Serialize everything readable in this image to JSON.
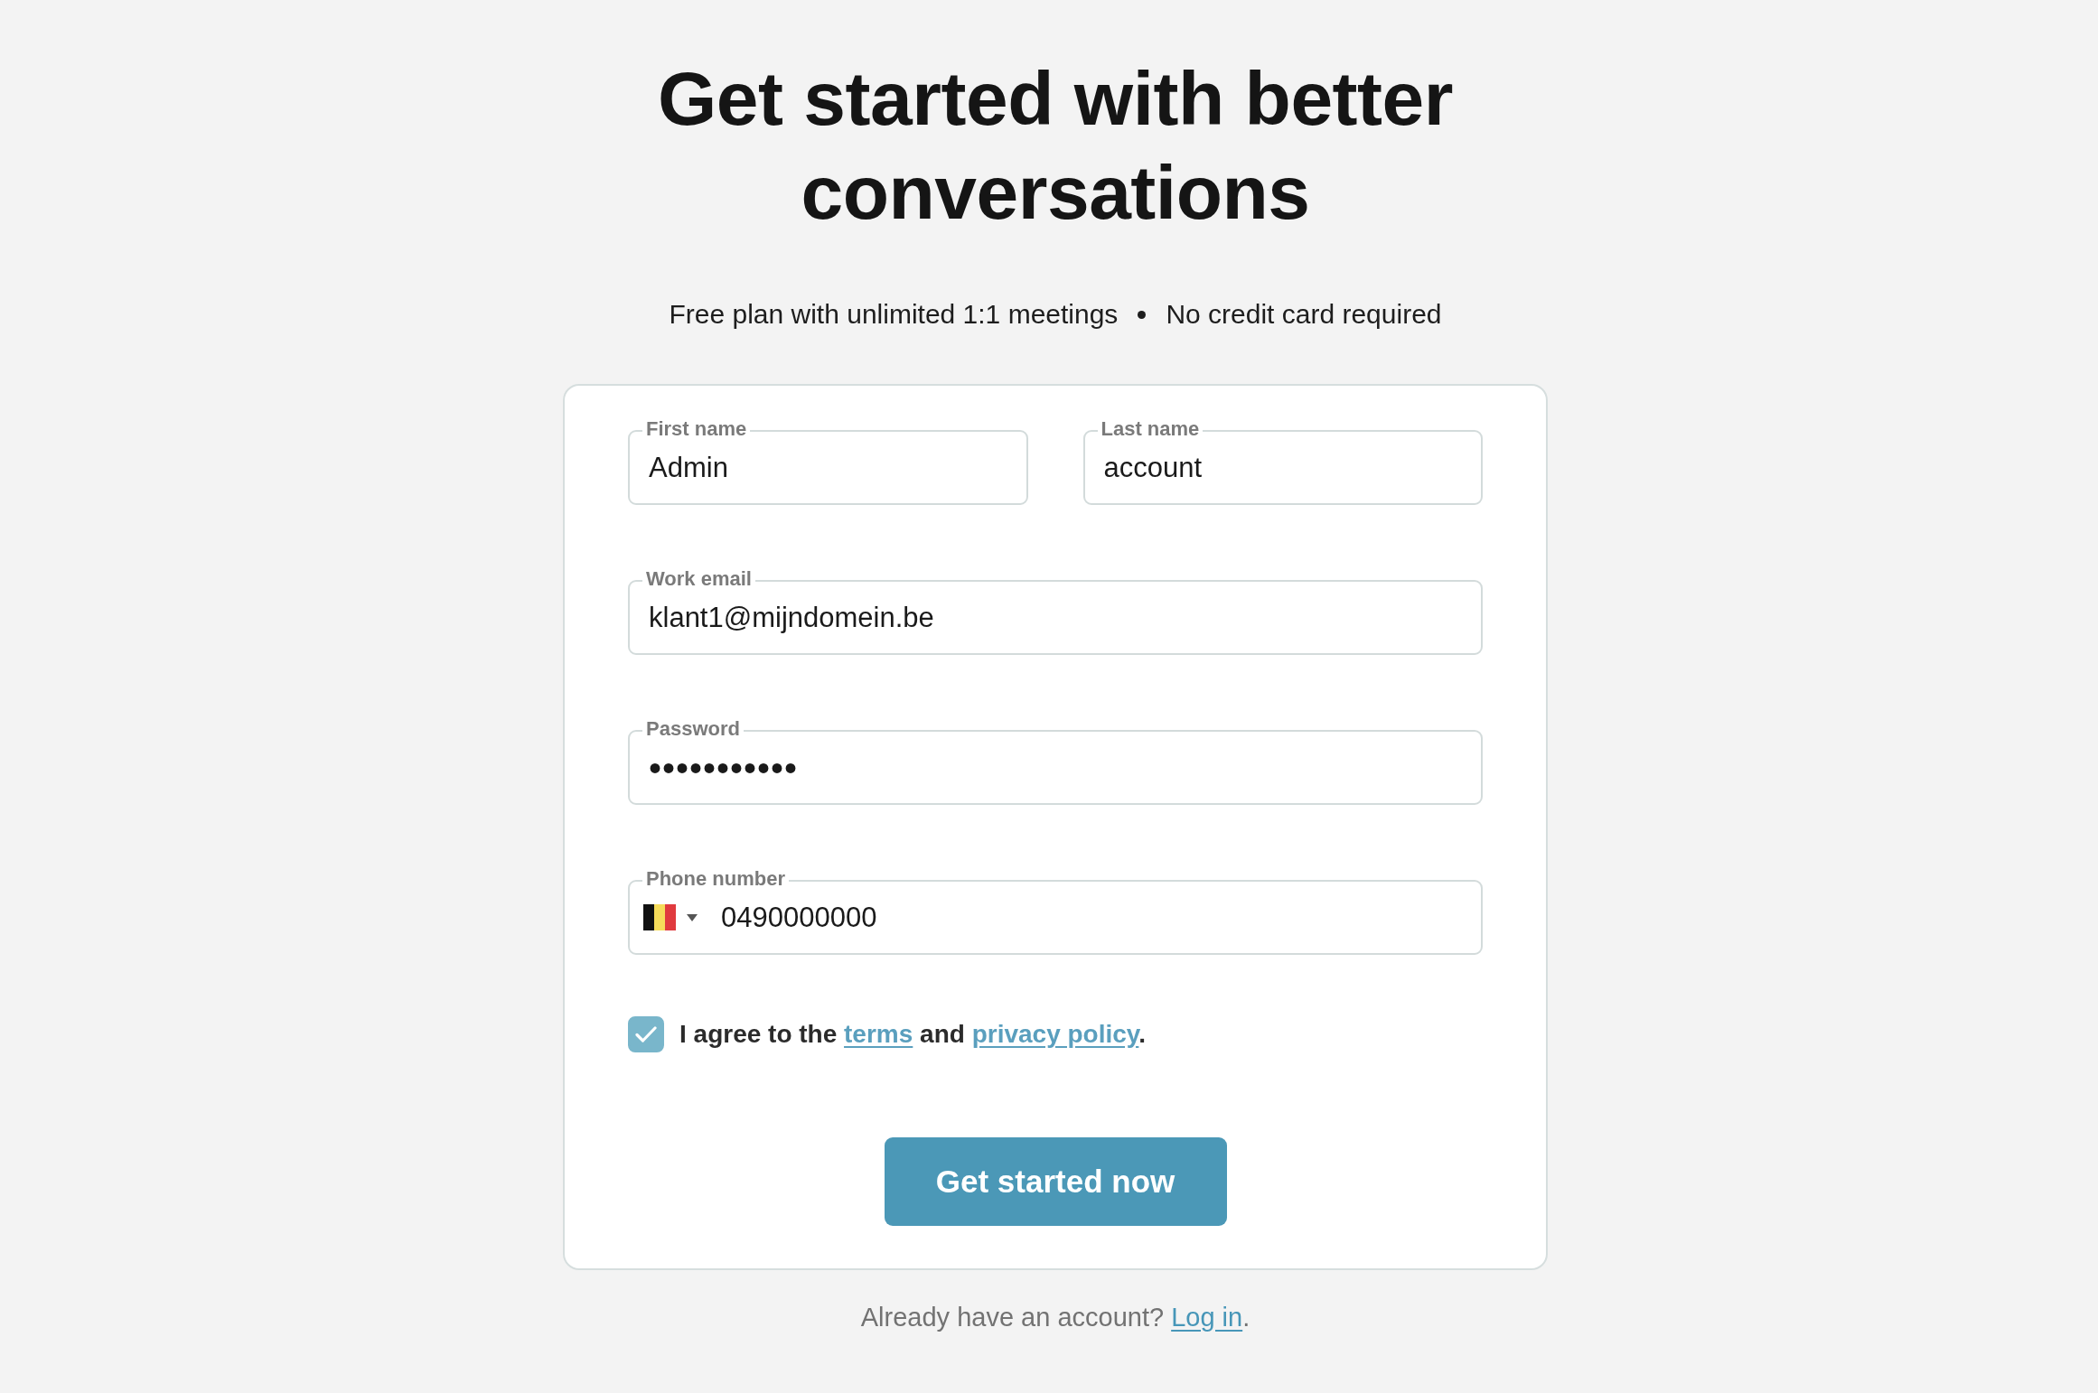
{
  "heading": "Get started with better conversations",
  "perks": [
    "Free plan with unlimited 1:1 meetings",
    "No credit card required"
  ],
  "form": {
    "rows": [
      [
        {
          "kind": "text",
          "label": "First name",
          "value": "Admin"
        },
        {
          "kind": "text",
          "label": "Last name",
          "value": "account"
        }
      ],
      [
        {
          "kind": "email",
          "label": "Work email",
          "value": "klant1@mijndomein.be"
        }
      ],
      [
        {
          "kind": "password",
          "label": "Password",
          "value": "•••••••••••"
        }
      ],
      [
        {
          "kind": "phone",
          "label": "Phone number",
          "value": "0490000000"
        }
      ]
    ],
    "consent": {
      "checked": true,
      "text_before": "I agree to the",
      "terms_link": "terms",
      "text_middle": "and",
      "privacy_link": "privacy policy",
      "text_after": "."
    },
    "submit": "Get started now"
  },
  "footer": {
    "text": "Already have an account?",
    "link": "Log in",
    "text_after": "."
  }
}
